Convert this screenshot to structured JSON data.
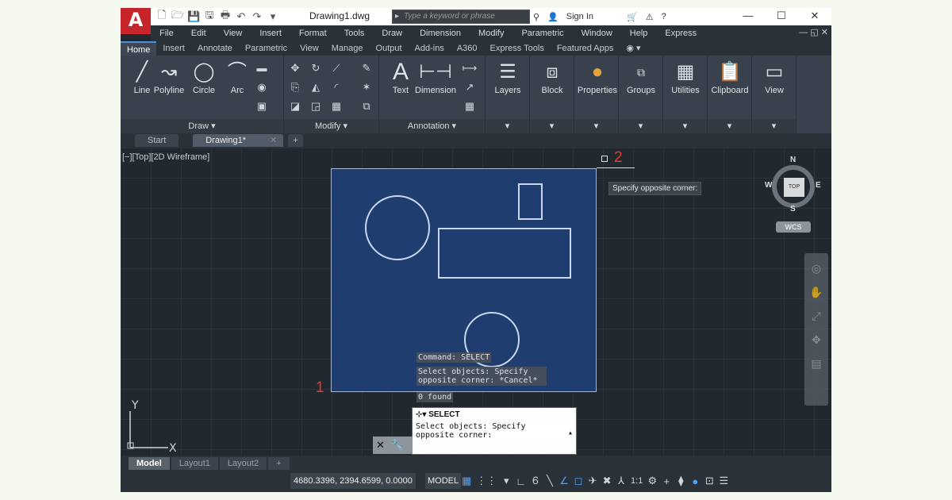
{
  "title_bar": {
    "document_title": "Drawing1.dwg",
    "search_placeholder": "Type a keyword or phrase",
    "sign_in": "Sign In"
  },
  "menu": [
    "File",
    "Edit",
    "View",
    "Insert",
    "Format",
    "Tools",
    "Draw",
    "Dimension",
    "Modify",
    "Parametric",
    "Window",
    "Help",
    "Express"
  ],
  "ribbon_tabs": [
    "Home",
    "Insert",
    "Annotate",
    "Parametric",
    "View",
    "Manage",
    "Output",
    "Add-ins",
    "A360",
    "Express Tools",
    "Featured Apps"
  ],
  "ribbon": {
    "draw_tools": [
      "Line",
      "Polyline",
      "Circle",
      "Arc"
    ],
    "draw_panel": "Draw ▾",
    "modify_panel": "Modify ▾",
    "annotation_tools": [
      "Text",
      "Dimension"
    ],
    "annotation_panel": "Annotation ▾",
    "big_tools": [
      "Layers",
      "Block",
      "Properties",
      "Groups",
      "Utilities",
      "Clipboard",
      "View"
    ]
  },
  "file_tabs": [
    "Start",
    "Drawing1*"
  ],
  "viewport": {
    "label": "[−][Top][2D Wireframe]",
    "tooltip": "Specify opposite corner:",
    "marker_1": "1",
    "marker_2": "2",
    "history": [
      "Command: SELECT",
      "Select objects: Specify",
      "opposite corner: *Cancel*",
      "0 found"
    ],
    "command": "SELECT",
    "prompt": "Select objects: Specify opposite corner:",
    "compass": {
      "N": "N",
      "S": "S",
      "E": "E",
      "W": "W",
      "cube": "TOP",
      "wcs": "WCS"
    },
    "ucs": {
      "x": "X",
      "y": "Y"
    }
  },
  "layout_tabs": [
    "Model",
    "Layout1",
    "Layout2"
  ],
  "status": {
    "coordinates": "4680.3396, 2394.6599, 0.0000",
    "space": "MODEL",
    "scale": "1:1"
  }
}
